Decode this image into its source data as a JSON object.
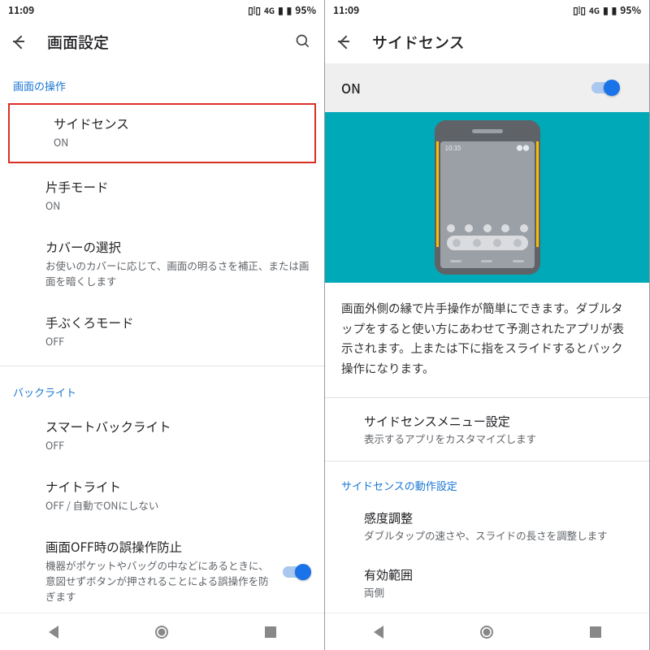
{
  "statusbar": {
    "time": "11:09",
    "network": "4G",
    "battery": "95%"
  },
  "left": {
    "title": "画面設定",
    "sections": {
      "screen_ops": {
        "header": "画面の操作",
        "side_sense": {
          "label": "サイドセンス",
          "sub": "ON"
        },
        "one_hand": {
          "label": "片手モード",
          "sub": "ON"
        },
        "cover": {
          "label": "カバーの選択",
          "sub": "お使いのカバーに応じて、画面の明るさを補正、または画面を暗くします"
        },
        "glove": {
          "label": "手ぶくろモード",
          "sub": "OFF"
        }
      },
      "backlight": {
        "header": "バックライト",
        "smart": {
          "label": "スマートバックライト",
          "sub": "OFF"
        },
        "night": {
          "label": "ナイトライト",
          "sub": "OFF / 自動でONにしない"
        },
        "pocket": {
          "label": "画面OFF時の誤操作防止",
          "sub": "機器がポケットやバッグの中などにあるときに、意図せずボタンが押されることによる誤操作を防ぎます",
          "toggle": true
        }
      }
    }
  },
  "right": {
    "title": "サイドセンス",
    "on_label": "ON",
    "hero_clock": "10:35",
    "description": "画面外側の縁で片手操作が簡単にできます。ダブルタップをすると使い方にあわせて予測されたアプリが表示されます。上または下に指をスライドするとバック操作になります。",
    "menu_setting": {
      "label": "サイドセンスメニュー設定",
      "sub": "表示するアプリをカスタマイズします"
    },
    "behavior_header": "サイドセンスの動作設定",
    "sensitivity": {
      "label": "感度調整",
      "sub": "ダブルタップの速さや、スライドの長さを調整します"
    },
    "active_area": {
      "label": "有効範囲",
      "sub": "両側"
    }
  }
}
